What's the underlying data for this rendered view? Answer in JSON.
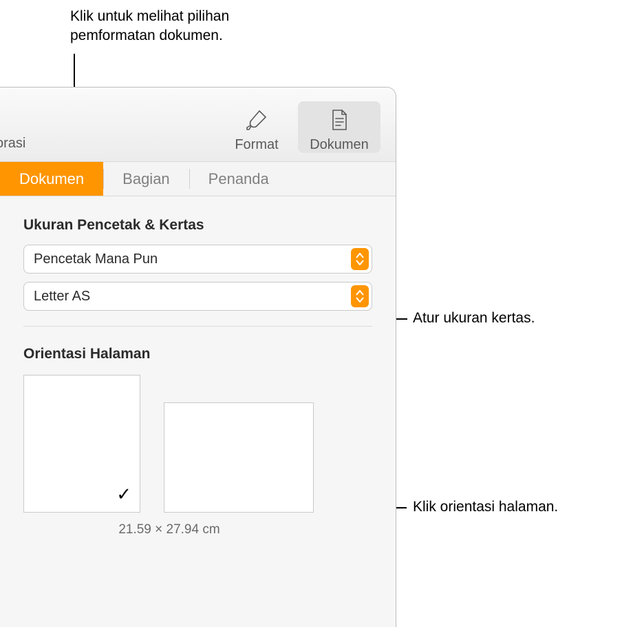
{
  "callouts": {
    "top": "Klik untuk melihat pilihan pemformatan dokumen.",
    "paper": "Atur ukuran kertas.",
    "orientation": "Klik orientasi halaman."
  },
  "toolbar": {
    "left_truncated": "orasi",
    "format": "Format",
    "dokumen": "Dokumen"
  },
  "tabs": {
    "dokumen": "Dokumen",
    "bagian": "Bagian",
    "penanda": "Penanda"
  },
  "sections": {
    "printer_paper": "Ukuran Pencetak & Kertas",
    "orientation": "Orientasi Halaman"
  },
  "popups": {
    "printer": "Pencetak Mana Pun",
    "paper": "Letter AS"
  },
  "dimensions": "21.59 × 27.94 cm"
}
